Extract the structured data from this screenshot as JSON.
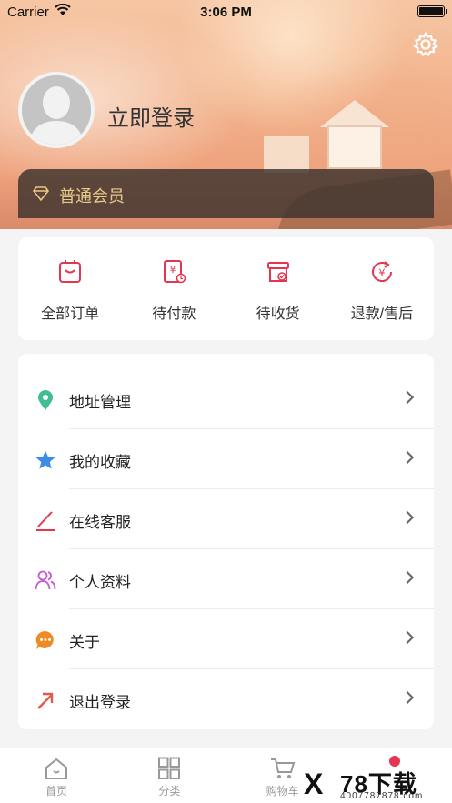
{
  "status_bar": {
    "carrier": "Carrier",
    "time": "3:06 PM"
  },
  "header": {
    "login_label": "立即登录",
    "member_label": "普通会员"
  },
  "orders": [
    {
      "label": "全部订单",
      "icon": "all-orders-icon"
    },
    {
      "label": "待付款",
      "icon": "pending-payment-icon"
    },
    {
      "label": "待收货",
      "icon": "pending-receipt-icon"
    },
    {
      "label": "退款/售后",
      "icon": "refund-icon"
    }
  ],
  "menu": [
    {
      "label": "地址管理",
      "icon": "location-pin-icon"
    },
    {
      "label": "我的收藏",
      "icon": "star-icon"
    },
    {
      "label": "在线客服",
      "icon": "pen-icon"
    },
    {
      "label": "个人资料",
      "icon": "user-profile-icon"
    },
    {
      "label": "关于",
      "icon": "chat-bubble-icon"
    },
    {
      "label": "退出登录",
      "icon": "exit-arrow-icon"
    }
  ],
  "tabbar": [
    {
      "label": "首页",
      "icon": "home-icon"
    },
    {
      "label": "分类",
      "icon": "grid-icon"
    },
    {
      "label": "购物车",
      "icon": "cart-icon"
    }
  ],
  "watermark": {
    "brand": "78下载",
    "phone": "4007787878.com"
  },
  "colors": {
    "accent": "#e4364f",
    "member_gold": "#e8c98a"
  }
}
